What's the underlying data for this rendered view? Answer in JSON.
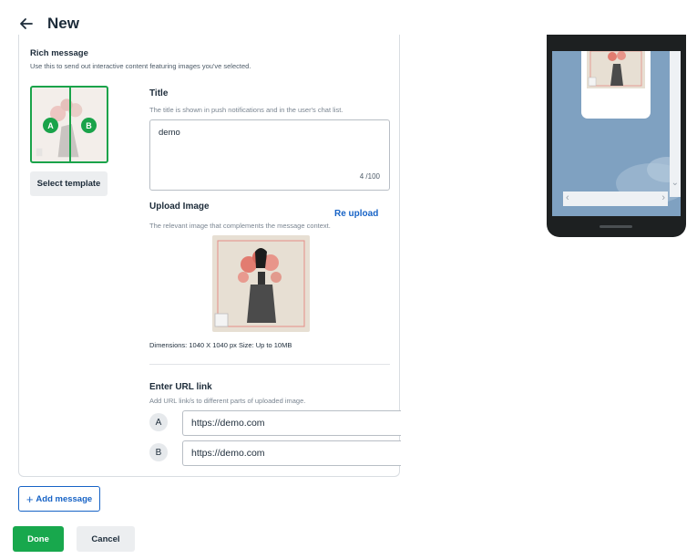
{
  "header": {
    "title": "New",
    "back_icon": "arrow-left-icon"
  },
  "rich_message": {
    "heading": "Rich message",
    "description": "Use this to send out interactive content featuring images you've selected.",
    "template": {
      "regions": [
        "A",
        "B"
      ],
      "select_label": "Select template"
    }
  },
  "title_field": {
    "label": "Title",
    "hint": "The title is shown in push notifications and in the user's chat list.",
    "value": "demo",
    "counter": "4 /100"
  },
  "upload": {
    "label": "Upload Image",
    "reupload_label": "Re upload",
    "hint": "The relevant image that complements the message context.",
    "dimensions": "Dimensions: 1040 X 1040 px Size: Up to 10MB"
  },
  "url_links": {
    "label": "Enter URL link",
    "hint": "Add URL link/s to different parts of uploaded image.",
    "items": [
      {
        "letter": "A",
        "url": "https://demo.com"
      },
      {
        "letter": "B",
        "url": "https://demo.com"
      }
    ]
  },
  "actions": {
    "add_message": "Add message",
    "done": "Done",
    "cancel": "Cancel"
  },
  "colors": {
    "accent_green": "#18a84d",
    "link_blue": "#1763c6",
    "phone_background": "#7fa1c1"
  }
}
